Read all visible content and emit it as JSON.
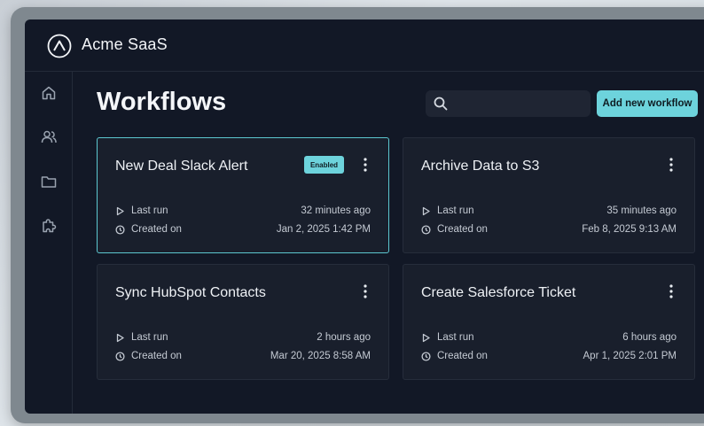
{
  "app": {
    "title": "Acme SaaS"
  },
  "page": {
    "title": "Workflows"
  },
  "search": {
    "placeholder": "",
    "value": ""
  },
  "actions": {
    "add_label": "Add new workflow"
  },
  "labels": {
    "last_run": "Last run",
    "created_on": "Created on"
  },
  "colors": {
    "accent": "#6dd3dc",
    "background": "#121826",
    "card": "#191f2c"
  },
  "sidebar": {
    "items": [
      {
        "name": "home",
        "icon": "home-icon"
      },
      {
        "name": "users",
        "icon": "users-icon"
      },
      {
        "name": "folder",
        "icon": "folder-icon"
      },
      {
        "name": "integrations",
        "icon": "puzzle-icon"
      }
    ]
  },
  "workflows": [
    {
      "title": "New Deal Slack Alert",
      "badge": "Enabled",
      "last_run": "32 minutes ago",
      "created_on": "Jan 2, 2025 1:42 PM",
      "active": true
    },
    {
      "title": "Archive Data to S3",
      "badge": "",
      "last_run": "35 minutes ago",
      "created_on": "Feb 8, 2025 9:13 AM",
      "active": false
    },
    {
      "title": "Sync HubSpot Contacts",
      "badge": "",
      "last_run": "2 hours ago",
      "created_on": "Mar 20, 2025 8:58 AM",
      "active": false
    },
    {
      "title": "Create Salesforce Ticket",
      "badge": "",
      "last_run": "6 hours ago",
      "created_on": "Apr 1, 2025 2:01 PM",
      "active": false
    }
  ]
}
